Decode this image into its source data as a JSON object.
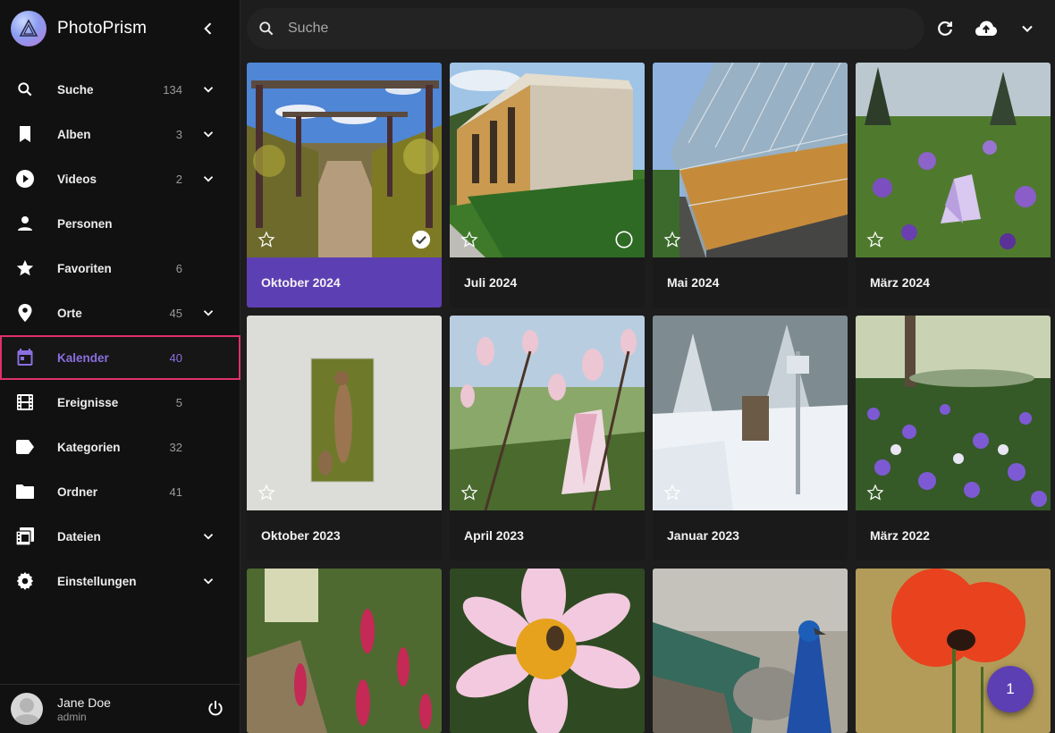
{
  "app": {
    "name": "PhotoPrism"
  },
  "search": {
    "placeholder": "Suche"
  },
  "sidebar": {
    "items": [
      {
        "label": "Suche",
        "count": "134",
        "icon": "search-icon",
        "expandable": true
      },
      {
        "label": "Alben",
        "count": "3",
        "icon": "bookmark-icon",
        "expandable": true
      },
      {
        "label": "Videos",
        "count": "2",
        "icon": "play-circle-icon",
        "expandable": true
      },
      {
        "label": "Personen",
        "count": "",
        "icon": "person-icon",
        "expandable": false
      },
      {
        "label": "Favoriten",
        "count": "6",
        "icon": "star-icon",
        "expandable": false
      },
      {
        "label": "Orte",
        "count": "45",
        "icon": "map-pin-icon",
        "expandable": true
      },
      {
        "label": "Kalender",
        "count": "40",
        "icon": "calendar-icon",
        "expandable": false,
        "active": true
      },
      {
        "label": "Ereignisse",
        "count": "5",
        "icon": "film-icon",
        "expandable": false
      },
      {
        "label": "Kategorien",
        "count": "32",
        "icon": "label-icon",
        "expandable": false
      },
      {
        "label": "Ordner",
        "count": "41",
        "icon": "folder-icon",
        "expandable": false
      },
      {
        "label": "Dateien",
        "count": "",
        "icon": "files-icon",
        "expandable": true
      },
      {
        "label": "Einstellungen",
        "count": "",
        "icon": "gear-icon",
        "expandable": true
      }
    ]
  },
  "user": {
    "name": "Jane Doe",
    "role": "admin"
  },
  "albums": [
    {
      "title": "Oktober 2024",
      "selected": true
    },
    {
      "title": "Juli 2024",
      "selected": false
    },
    {
      "title": "Mai 2024",
      "selected": false
    },
    {
      "title": "März 2024",
      "selected": false
    },
    {
      "title": "Oktober 2023",
      "selected": false
    },
    {
      "title": "April 2023",
      "selected": false
    },
    {
      "title": "Januar 2023",
      "selected": false
    },
    {
      "title": "März 2022",
      "selected": false
    },
    {
      "title": "",
      "selected": false
    },
    {
      "title": "",
      "selected": false
    },
    {
      "title": "",
      "selected": false
    },
    {
      "title": "",
      "selected": false
    }
  ],
  "fab": {
    "count": "1"
  },
  "colors": {
    "accent": "#5d3fb4",
    "active_outline": "#e0306e",
    "active_text": "#8a6fe0"
  }
}
